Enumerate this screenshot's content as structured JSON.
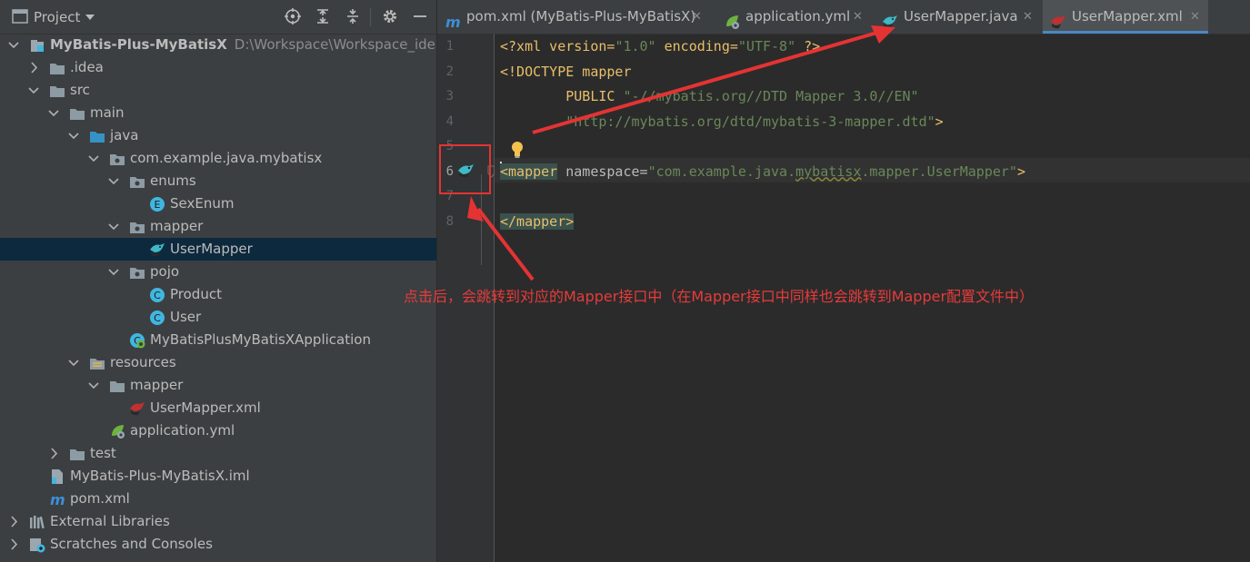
{
  "project_panel": {
    "title": "Project",
    "toolbar_icons": [
      "target-icon",
      "collapse-all-icon",
      "expand-all-icon",
      "gear-icon",
      "minimize-icon"
    ],
    "tree": [
      {
        "label": "MyBatis-Plus-MyBatisX",
        "hint": "D:\\Workspace\\Workspace_idea\\J",
        "icon": "module-icon",
        "bold": true,
        "expanded": true
      },
      {
        "label": ".idea",
        "icon": "folder-icon",
        "expanded": false
      },
      {
        "label": "src",
        "icon": "folder-icon",
        "expanded": true
      },
      {
        "label": "main",
        "icon": "folder-icon",
        "expanded": true
      },
      {
        "label": "java",
        "icon": "source-folder-icon",
        "expanded": true
      },
      {
        "label": "com.example.java.mybatisx",
        "icon": "package-icon",
        "expanded": true
      },
      {
        "label": "enums",
        "icon": "package-icon",
        "expanded": true
      },
      {
        "label": "SexEnum",
        "icon": "enum-icon"
      },
      {
        "label": "mapper",
        "icon": "package-icon",
        "expanded": true
      },
      {
        "label": "UserMapper",
        "icon": "mybatis-bird-icon",
        "selected": true
      },
      {
        "label": "pojo",
        "icon": "package-icon",
        "expanded": true
      },
      {
        "label": "Product",
        "icon": "class-icon"
      },
      {
        "label": "User",
        "icon": "class-icon"
      },
      {
        "label": "MyBatisPlusMyBatisXApplication",
        "icon": "spring-boot-class-icon"
      },
      {
        "label": "resources",
        "icon": "resources-folder-icon",
        "expanded": true
      },
      {
        "label": "mapper",
        "icon": "folder-icon",
        "expanded": true
      },
      {
        "label": "UserMapper.xml",
        "icon": "mybatis-xml-icon"
      },
      {
        "label": "application.yml",
        "icon": "spring-yml-icon"
      },
      {
        "label": "test",
        "icon": "folder-icon",
        "expanded": false
      },
      {
        "label": "MyBatis-Plus-MyBatisX.iml",
        "icon": "iml-file-icon"
      },
      {
        "label": "pom.xml",
        "icon": "maven-icon"
      },
      {
        "label": "External Libraries",
        "icon": "libraries-icon",
        "expanded": false
      },
      {
        "label": "Scratches and Consoles",
        "icon": "scratches-icon",
        "expanded": false
      }
    ]
  },
  "tabs": [
    {
      "label": "pom.xml (MyBatis-Plus-MyBatisX)",
      "icon": "maven-icon",
      "active": false
    },
    {
      "label": "application.yml",
      "icon": "spring-yml-icon",
      "active": false
    },
    {
      "label": "UserMapper.java",
      "icon": "mybatis-bird-icon",
      "active": false
    },
    {
      "label": "UserMapper.xml",
      "icon": "mybatis-xml-icon",
      "active": true
    }
  ],
  "editor": {
    "line_numbers": [
      "1",
      "2",
      "3",
      "4",
      "5",
      "6",
      "7",
      "8"
    ],
    "current_line": "6",
    "lines": [
      [
        {
          "t": "<?xml version=",
          "c": "tag"
        },
        {
          "t": "\"1.0\"",
          "c": "str"
        },
        {
          "t": " encoding=",
          "c": "tag"
        },
        {
          "t": "\"UTF-8\"",
          "c": "str"
        },
        {
          "t": " ?>",
          "c": "tag"
        }
      ],
      [
        {
          "t": "<!DOCTYPE mapper",
          "c": "tag"
        }
      ],
      [
        {
          "t": "        PUBLIC ",
          "c": "tag"
        },
        {
          "t": "\"-//mybatis.org//DTD Mapper 3.0//EN\"",
          "c": "str"
        }
      ],
      [
        {
          "t": "        ",
          "c": "plain"
        },
        {
          "t": "\"http://mybatis.org/dtd/mybatis-3-mapper.dtd\"",
          "c": "str"
        },
        {
          "t": ">",
          "c": "tag"
        }
      ],
      [],
      [
        {
          "t": "<mapper",
          "c": "tag",
          "hl": true
        },
        {
          "t": " namespace=",
          "c": "attr"
        },
        {
          "t": "\"com.example.java.",
          "c": "str"
        },
        {
          "t": "mybatisx",
          "c": "str",
          "under": true
        },
        {
          "t": ".mapper.UserMapper\"",
          "c": "str"
        },
        {
          "t": ">",
          "c": "tag"
        }
      ],
      [],
      [
        {
          "t": "</mapper>",
          "c": "tag",
          "hl": true
        }
      ]
    ]
  },
  "annotation": {
    "text": "点击后，会跳转到对应的Mapper接口中（在Mapper接口中同样也会跳转到Mapper配置文件中）",
    "color": "#e83b3b"
  },
  "colors": {
    "panel_bg": "#3c3f41",
    "editor_bg": "#2b2b2b",
    "selection": "#0d293e",
    "accent": "#4a88c7"
  }
}
